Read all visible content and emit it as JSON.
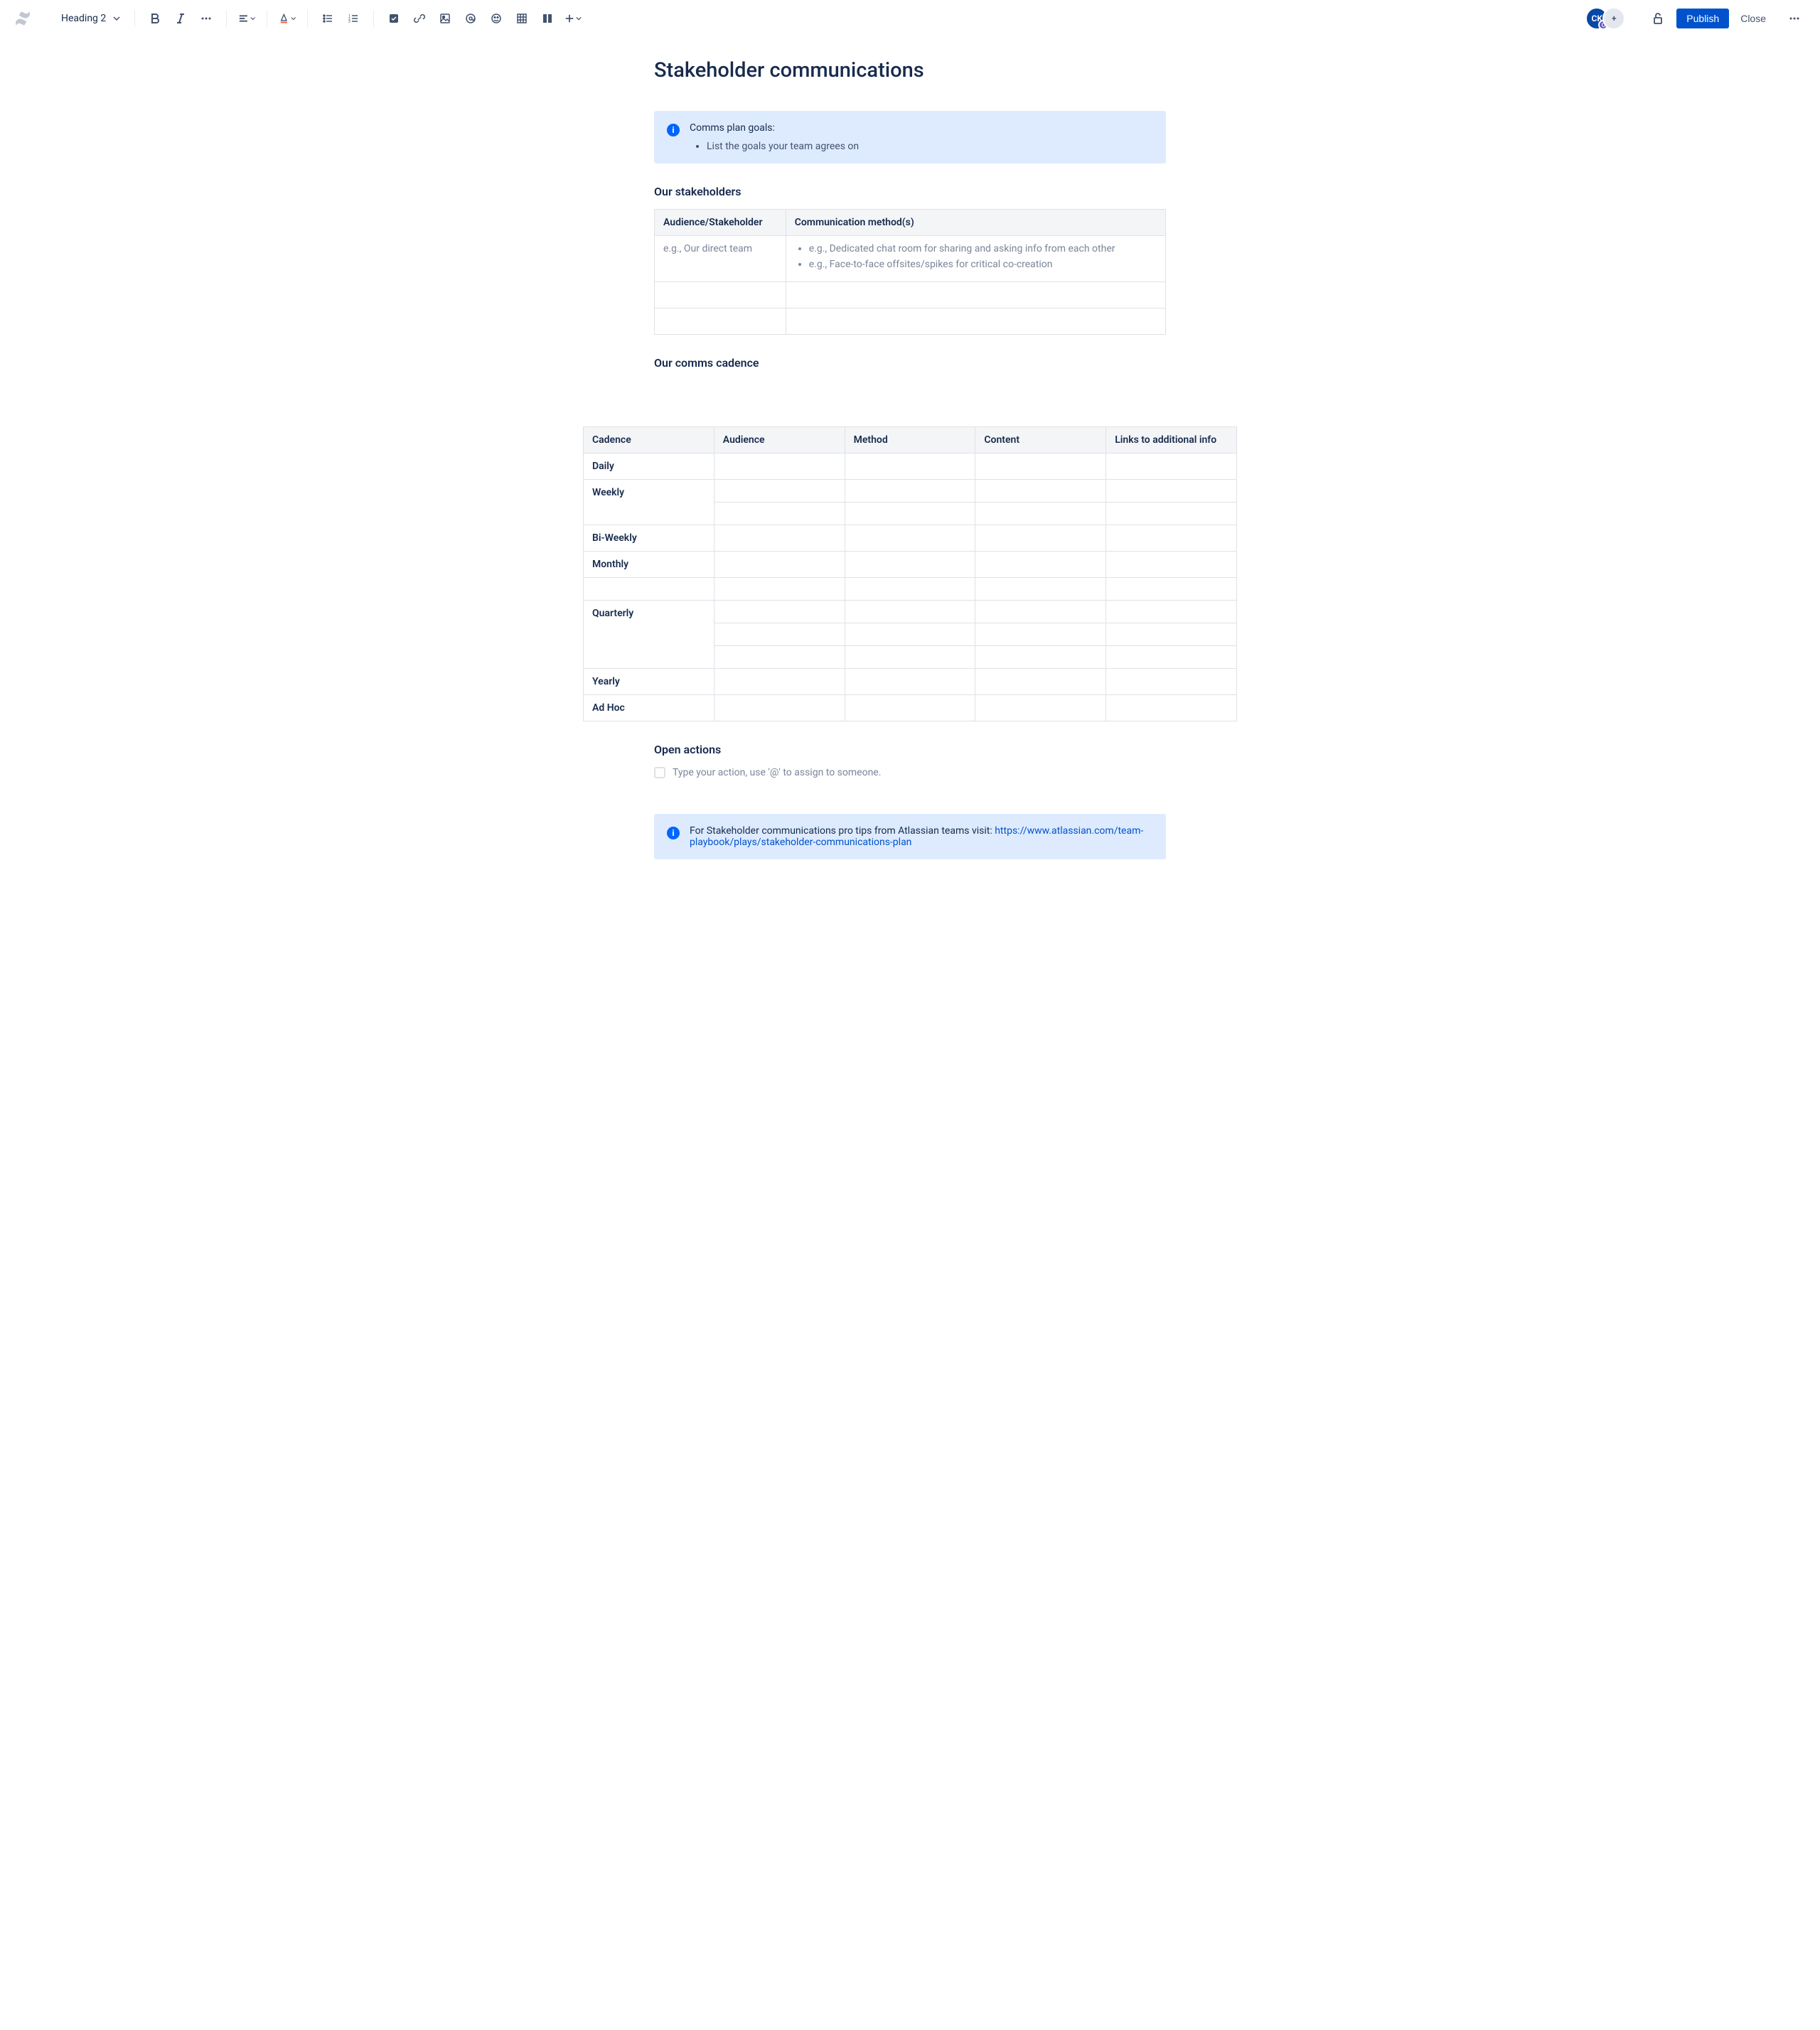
{
  "toolbar": {
    "heading_style": "Heading 2",
    "publish": "Publish",
    "close": "Close"
  },
  "avatar": {
    "initials": "CK",
    "badge": "C",
    "add": "+"
  },
  "page": {
    "title": "Stakeholder communications"
  },
  "info_panel_1": {
    "heading": "Comms plan goals:",
    "bullet": "List the goals your team agrees on"
  },
  "stakeholders": {
    "heading": "Our stakeholders",
    "col1": "Audience/Stakeholder",
    "col2": "Communication method(s)",
    "row1_col1": "e.g., Our direct team",
    "row1_col2_b1": "e.g., Dedicated chat room for sharing and asking info from each other",
    "row1_col2_b2": "e.g., Face-to-face offsites/spikes for critical co-creation"
  },
  "cadence": {
    "heading": "Our comms cadence",
    "col_cadence": "Cadence",
    "col_audience": "Audience",
    "col_method": "Method",
    "col_content": "Content",
    "col_links": "Links to additional info",
    "daily": "Daily",
    "weekly": "Weekly",
    "biweekly": "Bi-Weekly",
    "monthly": "Monthly",
    "quarterly": "Quarterly",
    "yearly": "Yearly",
    "adhoc": "Ad Hoc"
  },
  "open_actions": {
    "heading": "Open actions",
    "placeholder": "Type your action, use '@' to assign to someone."
  },
  "info_panel_2": {
    "text": "For Stakeholder communications pro tips from Atlassian teams visit: ",
    "link": "https://www.atlassian.com/team-playbook/plays/stakeholder-communications-plan"
  }
}
